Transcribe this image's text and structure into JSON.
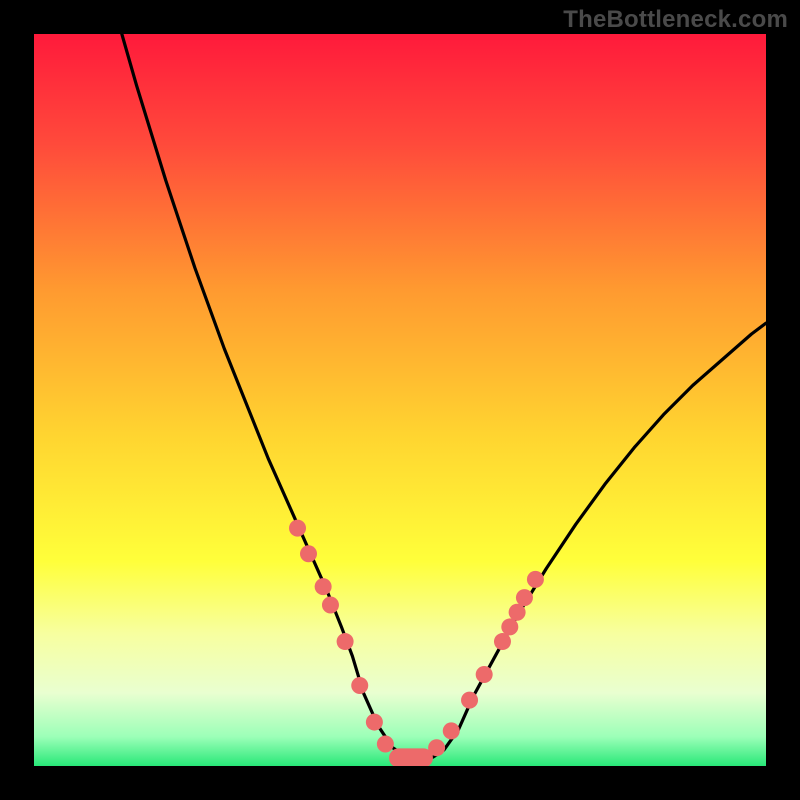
{
  "watermark": "TheBottleneck.com",
  "chart_data": {
    "type": "line",
    "title": "",
    "xlabel": "",
    "ylabel": "",
    "xlim": [
      0,
      100
    ],
    "ylim": [
      0,
      100
    ],
    "grid": false,
    "legend": false,
    "background_gradient": {
      "stops": [
        {
          "offset": 0.0,
          "color": "#ff1a3b"
        },
        {
          "offset": 0.15,
          "color": "#ff4a3b"
        },
        {
          "offset": 0.35,
          "color": "#ff9a30"
        },
        {
          "offset": 0.55,
          "color": "#ffd530"
        },
        {
          "offset": 0.72,
          "color": "#ffff3a"
        },
        {
          "offset": 0.82,
          "color": "#f7ffa0"
        },
        {
          "offset": 0.9,
          "color": "#e9ffd0"
        },
        {
          "offset": 0.96,
          "color": "#9cffb8"
        },
        {
          "offset": 1.0,
          "color": "#28e878"
        }
      ]
    },
    "series": [
      {
        "name": "curve",
        "type": "line",
        "color": "#000000",
        "x": [
          12,
          14,
          16,
          18,
          20,
          22,
          24,
          26,
          28,
          30,
          32,
          34,
          36,
          38,
          40,
          42,
          43.5,
          45,
          47,
          49,
          51,
          53,
          54.5,
          56,
          58,
          60,
          63,
          66,
          70,
          74,
          78,
          82,
          86,
          90,
          94,
          98,
          100
        ],
        "y": [
          100,
          93,
          86.5,
          80,
          74,
          68,
          62.5,
          57,
          52,
          47,
          42,
          37.5,
          33,
          28.5,
          24,
          19,
          15,
          10,
          5.5,
          2.5,
          1.2,
          1.0,
          1.2,
          2.2,
          5,
          9.5,
          15,
          20.5,
          27,
          33,
          38.5,
          43.5,
          48,
          52,
          55.5,
          59,
          60.5
        ]
      },
      {
        "name": "markers",
        "type": "scatter",
        "color": "#ed6a6a",
        "points": [
          {
            "x": 36.0,
            "y": 32.5
          },
          {
            "x": 37.5,
            "y": 29.0
          },
          {
            "x": 39.5,
            "y": 24.5
          },
          {
            "x": 40.5,
            "y": 22.0
          },
          {
            "x": 42.5,
            "y": 17.0
          },
          {
            "x": 44.5,
            "y": 11.0
          },
          {
            "x": 46.5,
            "y": 6.0
          },
          {
            "x": 48.0,
            "y": 3.0
          },
          {
            "x": 55.0,
            "y": 2.5
          },
          {
            "x": 57.0,
            "y": 4.8
          },
          {
            "x": 59.5,
            "y": 9.0
          },
          {
            "x": 61.5,
            "y": 12.5
          },
          {
            "x": 64.0,
            "y": 17.0
          },
          {
            "x": 65.0,
            "y": 19.0
          },
          {
            "x": 66.0,
            "y": 21.0
          },
          {
            "x": 67.0,
            "y": 23.0
          },
          {
            "x": 68.5,
            "y": 25.5
          }
        ]
      },
      {
        "name": "flat-marker",
        "type": "bar-segment",
        "color": "#ed6a6a",
        "x_start": 48.5,
        "x_end": 54.5,
        "y": 1.1,
        "thickness_pct": 2.6
      }
    ]
  }
}
